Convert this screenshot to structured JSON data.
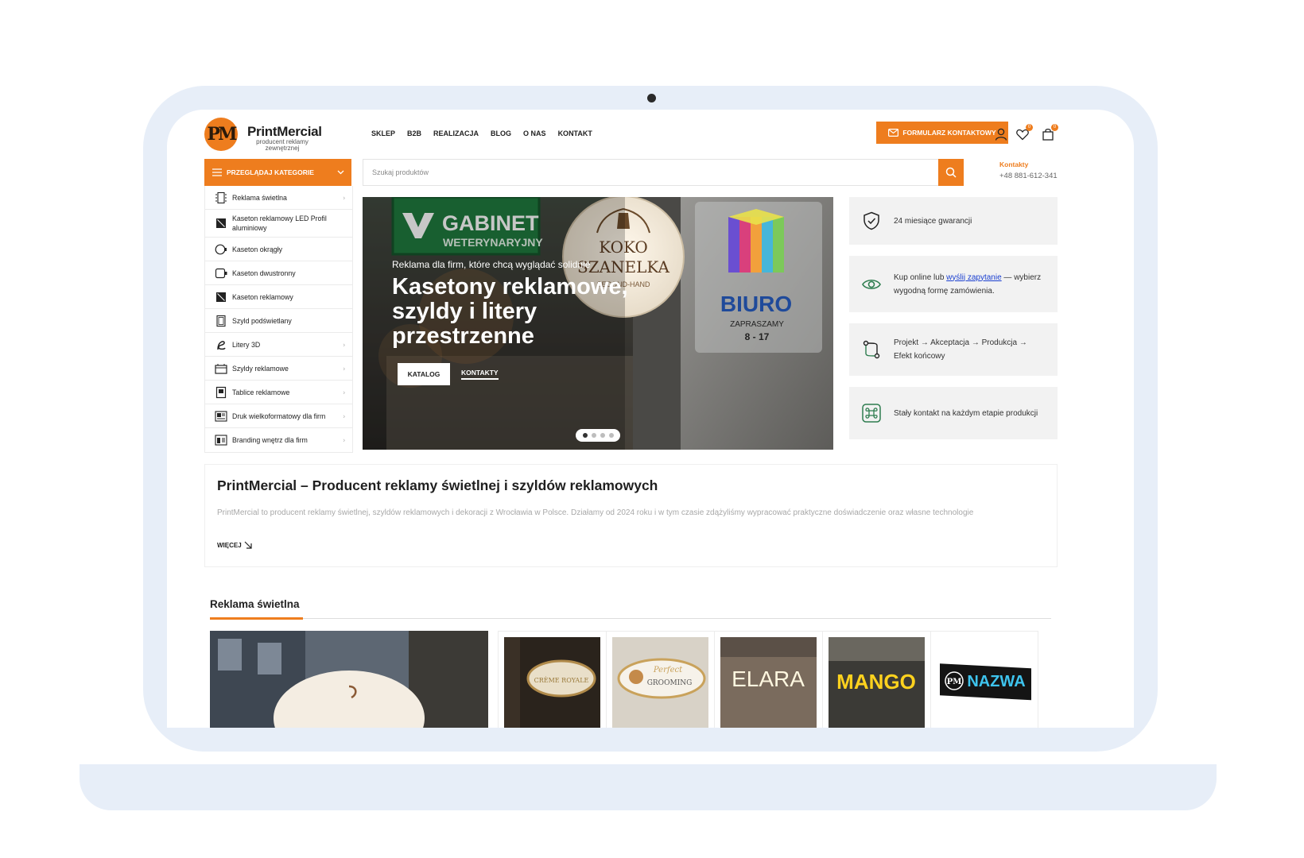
{
  "header": {
    "logo_mark": "PM",
    "logo_name": "PrintMercial",
    "logo_sub": "producent reklamy zewnętrznej",
    "nav": [
      "SKLEP",
      "B2B",
      "REALIZACJA",
      "BLOG",
      "O NAS",
      "KONTAKT"
    ],
    "cta_label": "FORMULARZ KONTAKTOWY",
    "wishlist_count": "0",
    "cart_count": "0"
  },
  "categories": {
    "heading": "PRZEGLĄDAJ KATEGORIE",
    "items": [
      {
        "label": "Reklama świetlna",
        "icon": "light-ad-icon",
        "arrow": "›"
      },
      {
        "label": "Kaseton reklamowy LED Profil aluminiowy",
        "icon": "led-box-icon",
        "arrow": ""
      },
      {
        "label": "Kaseton okrągły",
        "icon": "round-box-icon",
        "arrow": ""
      },
      {
        "label": "Kaseton dwustronny",
        "icon": "double-box-icon",
        "arrow": ""
      },
      {
        "label": "Kaseton reklamowy",
        "icon": "box-icon",
        "arrow": ""
      },
      {
        "label": "Szyld podświetlany",
        "icon": "backlit-sign-icon",
        "arrow": ""
      },
      {
        "label": "Litery 3D",
        "icon": "letters-3d-icon",
        "arrow": "›"
      },
      {
        "label": "Szyldy reklamowe",
        "icon": "sign-icon",
        "arrow": "›"
      },
      {
        "label": "Tablice reklamowe",
        "icon": "board-icon",
        "arrow": "›"
      },
      {
        "label": "Druk wielkoformatowy dla firm",
        "icon": "print-icon",
        "arrow": "›"
      },
      {
        "label": "Branding wnętrz dla firm",
        "icon": "branding-icon",
        "arrow": "›"
      }
    ]
  },
  "search": {
    "placeholder": "Szukaj produktów"
  },
  "contact": {
    "label": "Kontakty",
    "phone": "+48 881-612-341"
  },
  "hero": {
    "subtitle": "Reklama dla firm, które chcą wyglądać solidnie",
    "title": "Kasetony reklamowe, szyldy i litery przestrzenne",
    "button": "KATALOG",
    "link": "KONTAKTY",
    "sign_gabinet": "GABINET",
    "sign_weterynaryjny": "WETERYNARYJNY",
    "sign_koko": "KOKO",
    "sign_szanelka": "SZANELKA",
    "sign_secondhand": "SECOND-HAND",
    "sign_biuro": "BIURO",
    "sign_zapraszamy": "ZAPRASZAMY",
    "sign_hours": "8 - 17",
    "slide_count": 4,
    "active_slide": 1
  },
  "features": [
    {
      "icon": "shield-icon",
      "text": "24 miesiące gwarancji"
    },
    {
      "icon": "eye-icon",
      "text_before": "Kup online lub ",
      "link": "wyślij zapytanie",
      "text_after": " — wybierz wygodną formę zamówienia."
    },
    {
      "icon": "workflow-icon",
      "text": "Projekt → Akceptacja → Produkcja → Efekt końcowy"
    },
    {
      "icon": "command-icon",
      "text": "Stały kontakt na każdym etapie produkcji"
    }
  ],
  "about": {
    "title": "PrintMercial – Producent reklamy świetlnej i szyldów reklamowych",
    "text": "PrintMercial to producent reklamy świetlnej, szyldów reklamowych i dekoracji z Wrocławia w Polsce. Działamy od 2024 roku i w tym czasie zdążyliśmy wypracować praktyczne doświadczenie oraz własne technologie",
    "more": "WIĘCEJ"
  },
  "section": {
    "title": "Reklama świetlna",
    "products": [
      {
        "sign": "CRÈME ROYALE"
      },
      {
        "sign": "GROOMING",
        "script": "Perfect"
      },
      {
        "sign": "ELARA"
      },
      {
        "sign": "MANGO"
      },
      {
        "sign": "NAZWA",
        "mark": "PM"
      }
    ]
  },
  "colors": {
    "accent": "#ee7d1e",
    "frame": "#e7eef8",
    "feature_bg": "#f2f2f2"
  }
}
